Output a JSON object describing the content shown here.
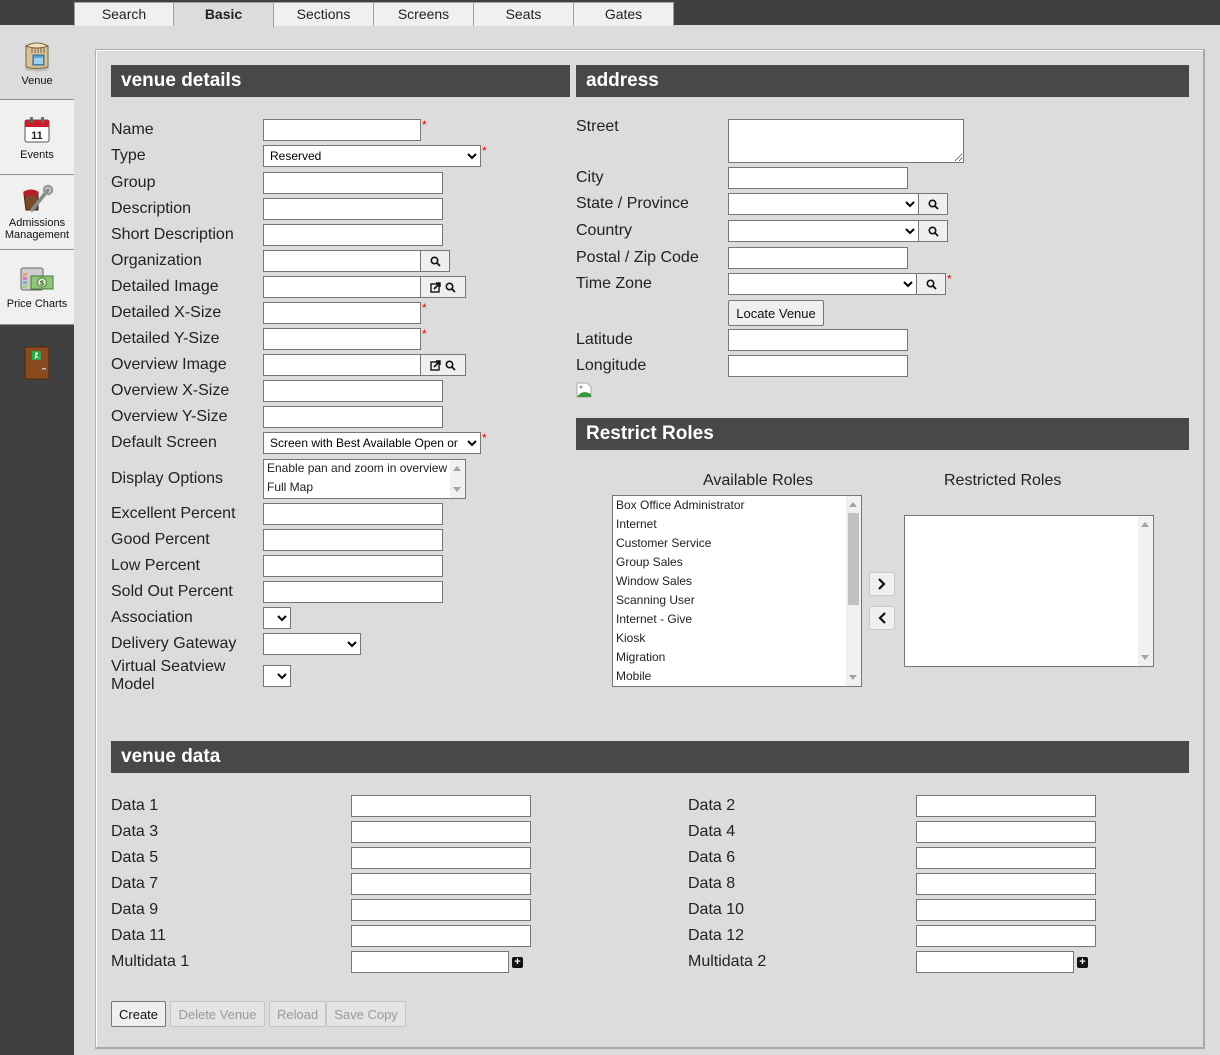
{
  "tabs": [
    {
      "label": "Search",
      "active": false
    },
    {
      "label": "Basic",
      "active": true
    },
    {
      "label": "Sections",
      "active": false
    },
    {
      "label": "Screens",
      "active": false
    },
    {
      "label": "Seats",
      "active": false
    },
    {
      "label": "Gates",
      "active": false
    }
  ],
  "sidebar": {
    "items": [
      {
        "label": "Venue",
        "icon": "venue-icon",
        "active": true
      },
      {
        "label": "Events",
        "icon": "calendar-icon",
        "active": false
      },
      {
        "label": "Admissions Management",
        "icon": "admissions-icon",
        "active": false
      },
      {
        "label": "Price Charts",
        "icon": "price-chart-icon",
        "active": false
      }
    ],
    "exit_icon": "exit-door-icon"
  },
  "venue_details": {
    "title": "venue details",
    "fields": {
      "name": {
        "label": "Name",
        "value": "",
        "required": true
      },
      "type": {
        "label": "Type",
        "value": "Reserved",
        "required": true
      },
      "group": {
        "label": "Group",
        "value": ""
      },
      "description": {
        "label": "Description",
        "value": ""
      },
      "short_description": {
        "label": "Short Description",
        "value": ""
      },
      "organization": {
        "label": "Organization",
        "value": ""
      },
      "detailed_image": {
        "label": "Detailed Image",
        "value": ""
      },
      "detailed_x": {
        "label": "Detailed X-Size",
        "value": "",
        "required": true
      },
      "detailed_y": {
        "label": "Detailed Y-Size",
        "value": "",
        "required": true
      },
      "overview_image": {
        "label": "Overview Image",
        "value": ""
      },
      "overview_x": {
        "label": "Overview X-Size",
        "value": ""
      },
      "overview_y": {
        "label": "Overview Y-Size",
        "value": ""
      },
      "default_screen": {
        "label": "Default Screen",
        "value": "Screen with Best Available Open or Best Available",
        "required": true
      },
      "display_options": {
        "label": "Display Options",
        "options": [
          "Enable pan and zoom in overview",
          "Full Map"
        ]
      },
      "excellent_percent": {
        "label": "Excellent Percent",
        "value": ""
      },
      "good_percent": {
        "label": "Good Percent",
        "value": ""
      },
      "low_percent": {
        "label": "Low Percent",
        "value": ""
      },
      "sold_out_percent": {
        "label": "Sold Out Percent",
        "value": ""
      },
      "association": {
        "label": "Association",
        "value": ""
      },
      "delivery_gateway": {
        "label": "Delivery Gateway",
        "value": ""
      },
      "virtual_seatview": {
        "label_line1": "Virtual Seatview",
        "label_line2": "Model",
        "value": ""
      }
    },
    "required_mark": "*"
  },
  "address": {
    "title": "address",
    "street": {
      "label": "Street",
      "value": ""
    },
    "city": {
      "label": "City",
      "value": ""
    },
    "state": {
      "label": "State / Province",
      "value": ""
    },
    "country": {
      "label": "Country",
      "value": ""
    },
    "postal": {
      "label": "Postal / Zip Code",
      "value": ""
    },
    "timezone": {
      "label": "Time Zone",
      "value": "",
      "required": true
    },
    "locate_button": "Locate Venue",
    "latitude": {
      "label": "Latitude",
      "value": ""
    },
    "longitude": {
      "label": "Longitude",
      "value": ""
    },
    "map_image_icon": "broken-image-icon"
  },
  "restrict_roles": {
    "title": "Restrict Roles",
    "available_label": "Available Roles",
    "restricted_label": "Restricted Roles",
    "available": [
      "Box Office Administrator",
      "Internet",
      "Customer Service",
      "Group Sales",
      "Window Sales",
      "Scanning User",
      "Internet - Give",
      "Kiosk",
      "Migration",
      "Mobile"
    ],
    "restricted": [],
    "add_icon": "chevron-right-icon",
    "remove_icon": "chevron-left-icon"
  },
  "venue_data": {
    "title": "venue data",
    "left": [
      {
        "label": "Data 1",
        "value": ""
      },
      {
        "label": "Data 3",
        "value": ""
      },
      {
        "label": "Data 5",
        "value": ""
      },
      {
        "label": "Data 7",
        "value": ""
      },
      {
        "label": "Data 9",
        "value": ""
      },
      {
        "label": "Data 11",
        "value": ""
      },
      {
        "label": "Multidata 1",
        "value": "",
        "multi": true
      }
    ],
    "right": [
      {
        "label": "Data 2",
        "value": ""
      },
      {
        "label": "Data 4",
        "value": ""
      },
      {
        "label": "Data 6",
        "value": ""
      },
      {
        "label": "Data 8",
        "value": ""
      },
      {
        "label": "Data 10",
        "value": ""
      },
      {
        "label": "Data 12",
        "value": ""
      },
      {
        "label": "Multidata 2",
        "value": "",
        "multi": true
      }
    ]
  },
  "actions": {
    "create": "Create",
    "delete": "Delete Venue",
    "reload": "Reload",
    "save_copy": "Save Copy"
  }
}
